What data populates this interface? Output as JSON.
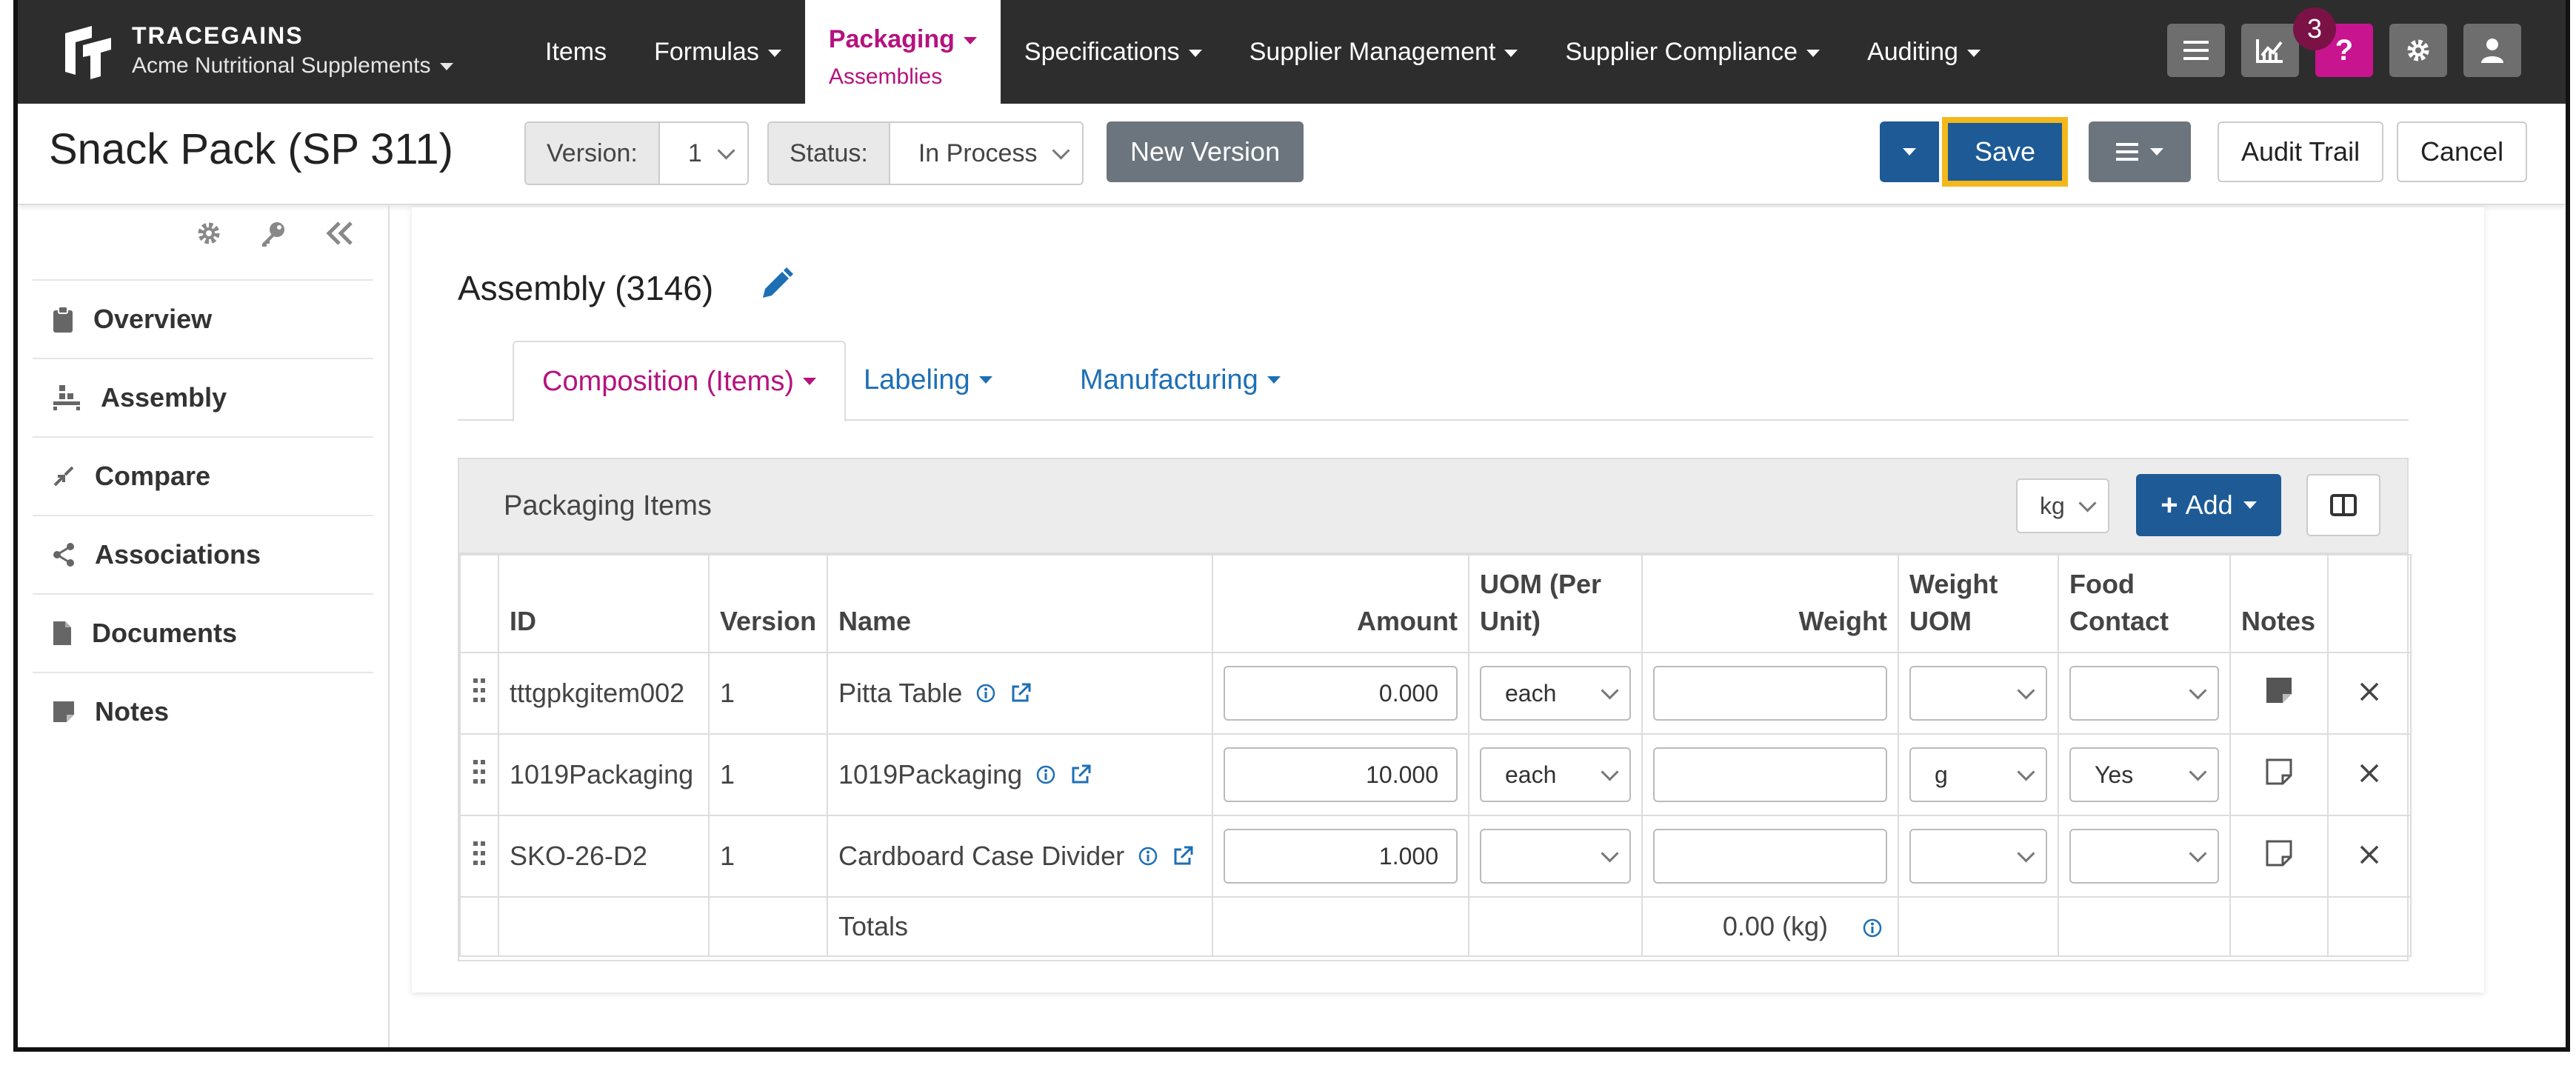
{
  "brand": {
    "name": "TRACEGAINS",
    "org": "Acme Nutritional Supplements"
  },
  "nav": [
    {
      "label": "Items",
      "dropdown": false
    },
    {
      "label": "Formulas",
      "dropdown": true
    },
    {
      "label": "Packaging",
      "sub": "Assemblies",
      "dropdown": true,
      "active": true
    },
    {
      "label": "Specifications",
      "dropdown": true
    },
    {
      "label": "Supplier Management",
      "dropdown": true
    },
    {
      "label": "Supplier Compliance",
      "dropdown": true
    },
    {
      "label": "Auditing",
      "dropdown": true
    }
  ],
  "tools": {
    "notification_count": "3"
  },
  "header": {
    "title": "Snack Pack (SP 311)",
    "version_label": "Version:",
    "version_value": "1",
    "status_label": "Status:",
    "status_value": "In Process",
    "new_version": "New Version",
    "save": "Save",
    "audit_trail": "Audit Trail",
    "cancel": "Cancel"
  },
  "sidebar": {
    "items": [
      {
        "label": "Overview",
        "icon": "clipboard-icon"
      },
      {
        "label": "Assembly",
        "icon": "assembly-icon"
      },
      {
        "label": "Compare",
        "icon": "compare-icon"
      },
      {
        "label": "Associations",
        "icon": "share-icon"
      },
      {
        "label": "Documents",
        "icon": "document-icon"
      },
      {
        "label": "Notes",
        "icon": "note-icon"
      }
    ]
  },
  "assembly": {
    "title": "Assembly (3146)"
  },
  "tabs": [
    {
      "label": "Composition (Items)",
      "active": true
    },
    {
      "label": "Labeling"
    },
    {
      "label": "Manufacturing"
    }
  ],
  "panel": {
    "title": "Packaging Items",
    "unit": "kg",
    "add_label": "Add",
    "columns": {
      "id": "ID",
      "version": "Version",
      "name": "Name",
      "amount": "Amount",
      "uom": "UOM (Per Unit)",
      "weight": "Weight",
      "weight_uom": "Weight UOM",
      "food_contact": "Food Contact",
      "notes": "Notes"
    },
    "rows": [
      {
        "id": "tttgpkgitem002",
        "version": "1",
        "name": "Pitta Table",
        "amount": "0.000",
        "uom": "each",
        "weight": "",
        "weight_uom": "",
        "food_contact": "",
        "has_note": true
      },
      {
        "id": "1019Packaging",
        "version": "1",
        "name": "1019Packaging",
        "amount": "10.000",
        "uom": "each",
        "weight": "",
        "weight_uom": "g",
        "food_contact": "Yes",
        "has_note": false
      },
      {
        "id": "SKO-26-D2",
        "version": "1",
        "name": "Cardboard Case Divider",
        "amount": "1.000",
        "uom": "",
        "weight": "",
        "weight_uom": "",
        "food_contact": "",
        "has_note": false
      }
    ],
    "totals_label": "Totals",
    "totals_weight": "0.00 (kg)"
  }
}
